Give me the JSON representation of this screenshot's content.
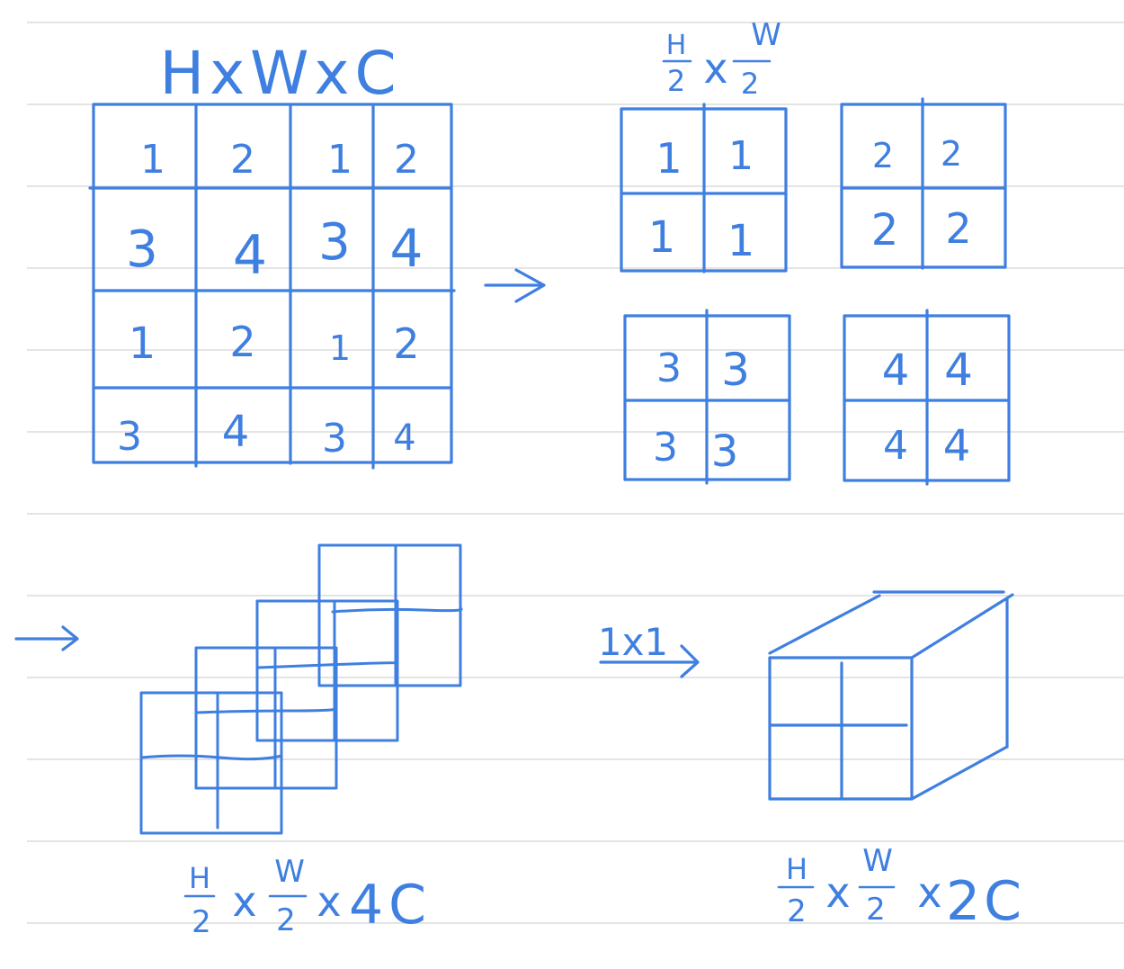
{
  "colors": {
    "ink": "#3f7fe0",
    "ruled_lines": "#d4d4d4",
    "paper": "#ffffff"
  },
  "input_grid": {
    "label": "HxWxC",
    "cells": [
      [
        "1",
        "2",
        "1",
        "2"
      ],
      [
        "3",
        "4",
        "3",
        "4"
      ],
      [
        "1",
        "2",
        "1",
        "2"
      ],
      [
        "3",
        "4",
        "3",
        "4"
      ]
    ]
  },
  "split_panel": {
    "label_num_h": "H",
    "label_den_h": "2",
    "label_times": "x",
    "label_num_w": "W",
    "label_den_w": "2",
    "sub_grids": [
      {
        "cells": [
          [
            "1",
            "1"
          ],
          [
            "1",
            "1"
          ]
        ]
      },
      {
        "cells": [
          [
            "2",
            "2"
          ],
          [
            "2",
            "2"
          ]
        ]
      },
      {
        "cells": [
          [
            "3",
            "3"
          ],
          [
            "3",
            "3"
          ]
        ]
      },
      {
        "cells": [
          [
            "4",
            "4"
          ],
          [
            "4",
            "4"
          ]
        ]
      }
    ]
  },
  "stacked_panel": {
    "num_h": "H",
    "den_h": "2",
    "x1": "x",
    "num_w": "W",
    "den_w": "2",
    "x2": "x",
    "tail": "4C"
  },
  "conv_label": "1x1",
  "output_panel": {
    "num_h": "H",
    "den_h": "2",
    "x1": "x",
    "num_w": "W",
    "den_w": "2",
    "x2": "x",
    "tail": "2C"
  },
  "icons": [
    "arrow-right-icon"
  ]
}
